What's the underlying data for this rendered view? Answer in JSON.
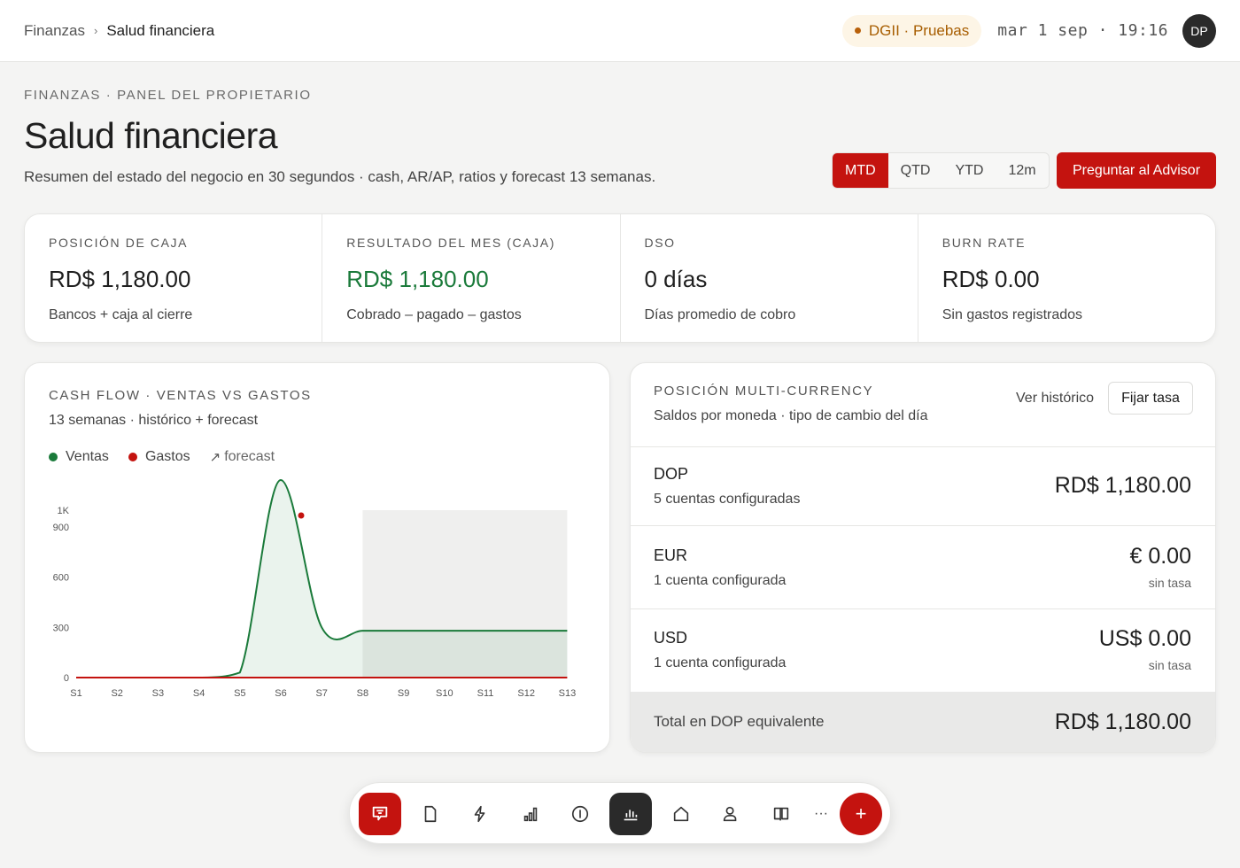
{
  "topbar": {
    "breadcrumb": {
      "root": "Finanzas",
      "separator": "›",
      "current": "Salud financiera"
    },
    "env_badge": "DGII · Pruebas",
    "clock": "mar 1 sep · 19:16",
    "avatar_initials": "DP"
  },
  "header": {
    "eyebrow": "FINANZAS · PANEL DEL PROPIETARIO",
    "title": "Salud financiera",
    "subtitle": "Resumen del estado del negocio en 30 segundos · cash, AR/AP, ratios y forecast 13 semanas.",
    "period_tabs": [
      "MTD",
      "QTD",
      "YTD",
      "12m"
    ],
    "active_period": "MTD",
    "ask_button": "Preguntar al Advisor"
  },
  "kpis": [
    {
      "label": "POSICIÓN DE CAJA",
      "value": "RD$ 1,180.00",
      "note": "Bancos + caja al cierre"
    },
    {
      "label": "RESULTADO DEL MES (CAJA)",
      "value": "RD$ 1,180.00",
      "note": "Cobrado – pagado – gastos"
    },
    {
      "label": "DSO",
      "value": "0 días",
      "note": "Días promedio de cobro"
    },
    {
      "label": "BURN RATE",
      "value": "RD$ 0.00",
      "note": "Sin gastos registrados"
    }
  ],
  "cashflow": {
    "eyebrow": "CASH FLOW · VENTAS VS GASTOS",
    "subtitle": "13 semanas · histórico + forecast",
    "legend": {
      "ventas": "Ventas",
      "gastos": "Gastos",
      "forecast": "forecast"
    }
  },
  "chart_data": {
    "type": "line",
    "x": [
      "S1",
      "S2",
      "S3",
      "S4",
      "S5",
      "S6",
      "S7",
      "S8",
      "S9",
      "S10",
      "S11",
      "S12",
      "S13"
    ],
    "ylim": [
      0,
      1000
    ],
    "yticks": [
      0,
      300,
      600,
      900,
      1000
    ],
    "ytick_labels": [
      "0",
      "300",
      "600",
      "900",
      "1K"
    ],
    "forecast_from": "S8",
    "series": [
      {
        "name": "Ventas",
        "color": "#1a7a3a",
        "values": [
          0,
          0,
          0,
          0,
          30,
          1180,
          300,
          280,
          280,
          280,
          280,
          280,
          280
        ]
      },
      {
        "name": "Gastos",
        "color": "#c4130f",
        "values": [
          0,
          0,
          0,
          0,
          0,
          0,
          0,
          0,
          0,
          0,
          0,
          0,
          0
        ]
      }
    ]
  },
  "fx": {
    "eyebrow": "POSICIÓN MULTI-CURRENCY",
    "subtitle": "Saldos por moneda · tipo de cambio del día",
    "history_link": "Ver histórico",
    "fix_rate_button": "Fijar tasa",
    "rows": [
      {
        "code": "DOP",
        "accounts": "5 cuentas configuradas",
        "amount": "RD$ 1,180.00",
        "rate": ""
      },
      {
        "code": "EUR",
        "accounts": "1 cuenta configurada",
        "amount": "€ 0.00",
        "rate": "sin tasa"
      },
      {
        "code": "USD",
        "accounts": "1 cuenta configurada",
        "amount": "US$ 0.00",
        "rate": "sin tasa"
      }
    ],
    "total_label": "Total en DOP equivalente",
    "total_value": "RD$ 1,180.00"
  },
  "dock": {
    "items": [
      "brand-icon",
      "document-icon",
      "lightning-icon",
      "bar-chart-icon",
      "info-icon",
      "analytics-icon",
      "home-icon",
      "user-icon",
      "book-icon",
      "more-icon",
      "add-icon"
    ],
    "more_label": "···",
    "add_label": "+"
  },
  "colors": {
    "accent": "#c4130f",
    "positive": "#1a7a3a",
    "env_badge_text": "#a75d00",
    "dark": "#2a2a2a"
  }
}
